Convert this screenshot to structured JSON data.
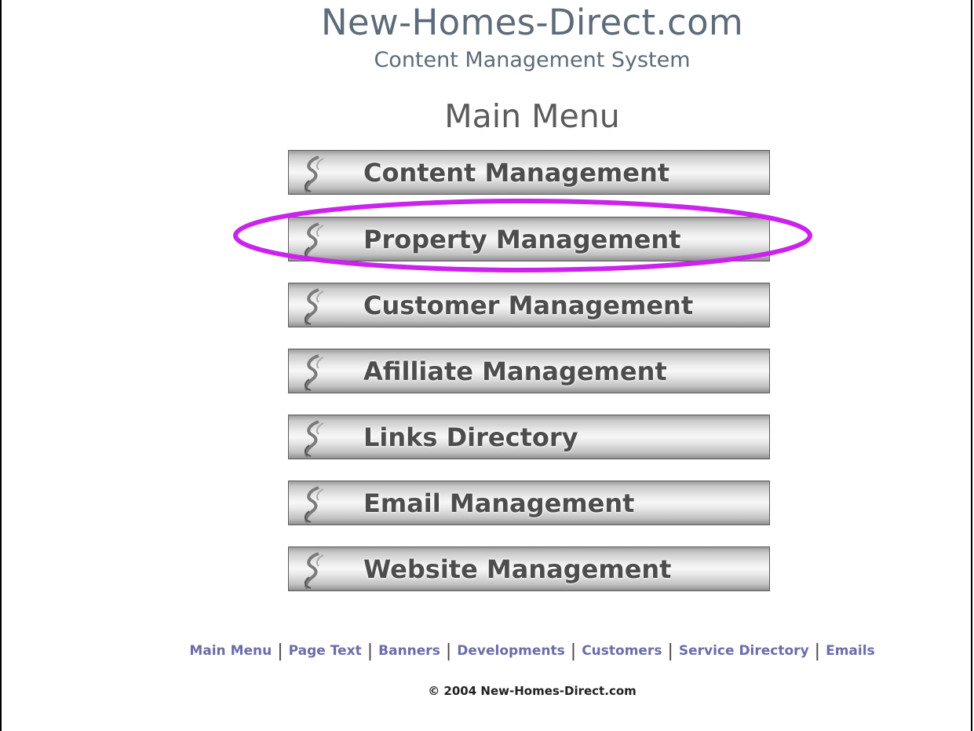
{
  "header": {
    "site_title": "New-Homes-Direct.com",
    "site_subtitle": "Content Management System",
    "menu_heading": "Main Menu"
  },
  "menu": {
    "items": [
      {
        "label": "Content Management",
        "icon": "swirl-icon"
      },
      {
        "label": "Property Management",
        "icon": "swirl-icon",
        "highlighted": true
      },
      {
        "label": "Customer Management",
        "icon": "swirl-icon"
      },
      {
        "label": "Afilliate Management",
        "icon": "swirl-icon"
      },
      {
        "label": "Links Directory",
        "icon": "swirl-icon"
      },
      {
        "label": "Email Management",
        "icon": "swirl-icon"
      },
      {
        "label": "Website Management",
        "icon": "swirl-icon"
      }
    ]
  },
  "footer": {
    "links": [
      "Main Menu",
      "Page Text",
      "Banners",
      "Developments",
      "Customers",
      "Service Directory",
      "Emails"
    ],
    "separator": "|",
    "copyright": "© 2004 New-Homes-Direct.com"
  },
  "colors": {
    "title_text": "#5e6b78",
    "button_text": "#4d4d4d",
    "footer_link": "#6c6ca8",
    "highlight_ring": "#cc22ee"
  }
}
